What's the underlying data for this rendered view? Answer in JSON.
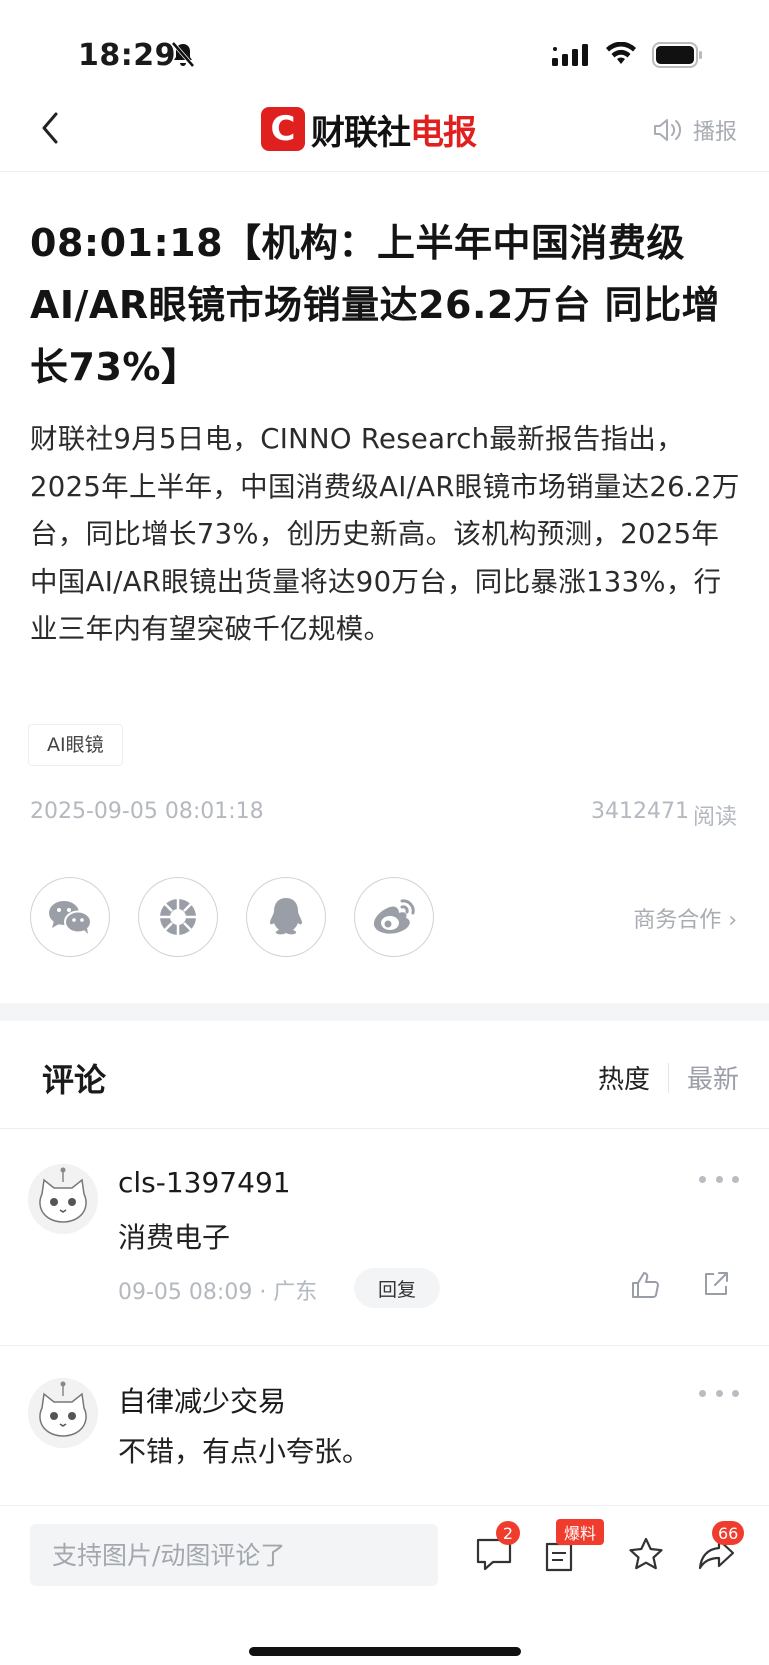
{
  "status_bar": {
    "time": "18:29"
  },
  "nav": {
    "brand_letter": "C",
    "brand_name_black": "财联社",
    "brand_name_red": "电报",
    "broadcast_label": "播报"
  },
  "article": {
    "headline": "08:01:18【机构：上半年中国消费级AI/AR眼镜市场销量达26.2万台 同比增长73%】",
    "body": "财联社9月5日电，CINNO Research最新报告指出，2025年上半年，中国消费级AI/AR眼镜市场销量达26.2万台，同比增长73%，创历史新高。该机构预测，2025年中国AI/AR眼镜出货量将达90万台，同比暴涨133%，行业三年内有望突破千亿规模。",
    "tag": "AI眼镜",
    "date": "2025-09-05 08:01:18",
    "read_count": "3412471",
    "read_label": "阅读",
    "business_link": "商务合作 ›"
  },
  "share_buttons": [
    {
      "icon": "wechat-icon"
    },
    {
      "icon": "moments-icon"
    },
    {
      "icon": "qq-icon"
    },
    {
      "icon": "weibo-icon"
    }
  ],
  "comments_section": {
    "title": "评论",
    "sort_hot": "热度",
    "sort_new": "最新",
    "items": [
      {
        "user": "cls-1397491",
        "text": "消费电子",
        "meta": "09-05 08:09 · 广东",
        "reply_label": "回复"
      },
      {
        "user": "自律减少交易",
        "text": "不错，有点小夸张。"
      }
    ]
  },
  "bottom_bar": {
    "input_placeholder": "支持图片/动图评论了",
    "comment_count": "2",
    "scoop_label": "爆料",
    "share_count": "66"
  },
  "colors": {
    "brand_red": "#e0201e",
    "badge_red": "#f03c2c",
    "muted_gray": "#b4b8bf"
  }
}
